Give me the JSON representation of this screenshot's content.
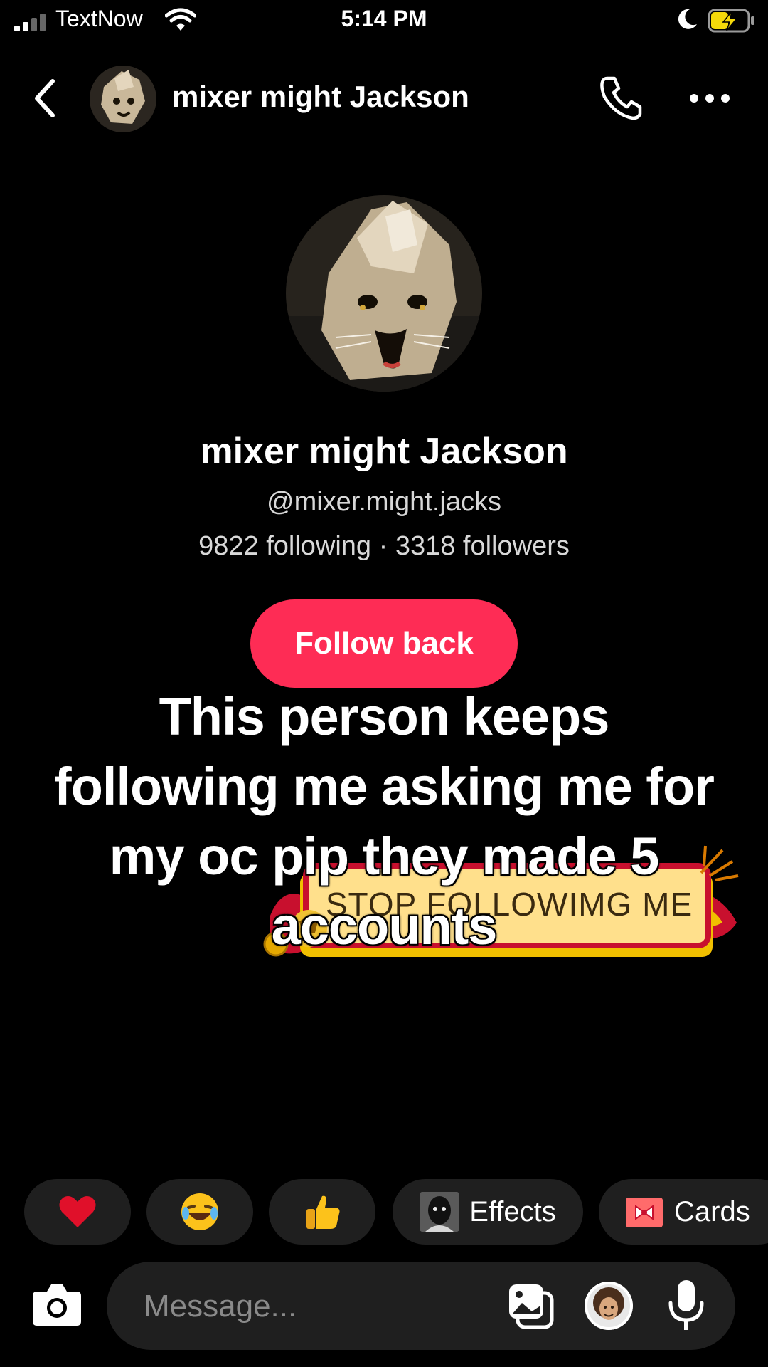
{
  "status_bar": {
    "carrier": "TextNow",
    "time": "5:14 PM"
  },
  "header": {
    "contact_name": "mixer might Jackson"
  },
  "profile": {
    "display_name": "mixer might Jackson",
    "handle": "@mixer.might.jacks",
    "stats": "9822 following · 3318 followers",
    "follow_button": "Follow back"
  },
  "sticker": {
    "text": "STOP FOLLOWIMG ME"
  },
  "caption": {
    "text": "This person keeps following me asking me for my oc pip they made 5 accounts"
  },
  "quick_actions": {
    "effects_label": "Effects",
    "cards_label": "Cards"
  },
  "composer": {
    "placeholder": "Message..."
  },
  "icons": {
    "back": "chevron-left-icon",
    "call": "phone-icon",
    "more": "more-icon",
    "camera": "camera-icon",
    "gallery": "gallery-icon",
    "mic": "microphone-icon",
    "heart": "heart-emoji",
    "laugh": "laughing-emoji",
    "thumbs_up": "thumbs-up-emoji",
    "gift": "gift-icon"
  },
  "colors": {
    "follow_button": "#fe2c55",
    "chip_background": "#1f1f1f",
    "battery_charge": "#f5d90a"
  }
}
